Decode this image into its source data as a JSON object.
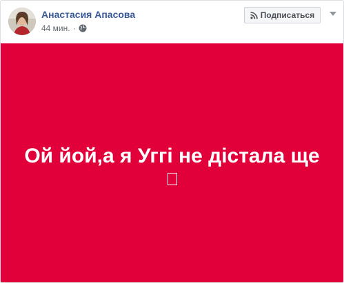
{
  "post": {
    "author_name": "Анастасия Апасова",
    "time": "44 мин.",
    "separator": "·",
    "privacy_icon": "globe-icon",
    "subscribe_label": "Подписаться",
    "subscribe_icon": "rss-icon",
    "options_icon": "caret-down-icon",
    "text": "Ой йой,а я Уггі не дістала ще",
    "background_color": "#e1003a"
  }
}
